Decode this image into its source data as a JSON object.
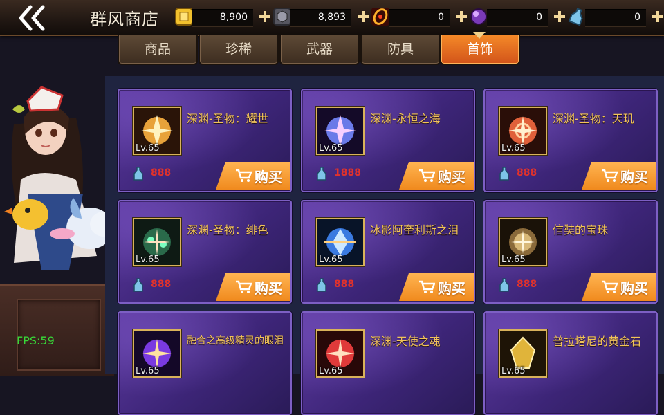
{
  "header": {
    "back_icon": "double-chevron-left-icon",
    "title": "群风商店",
    "currencies": [
      {
        "icon": "gold-coin-icon",
        "value": "8,900",
        "color": "#f2c12e"
      },
      {
        "icon": "silver-cube-icon",
        "value": "8,893",
        "color": "#a9a9b4"
      },
      {
        "icon": "fire-ring-icon",
        "value": "0",
        "color": "#e33c1f"
      },
      {
        "icon": "purple-orb-icon",
        "value": "0",
        "color": "#a05ad8"
      },
      {
        "icon": "blue-bottle-icon",
        "value": "0",
        "color": "#7ec4e8"
      }
    ],
    "plus_icon": "plus-icon"
  },
  "tabs": [
    {
      "label": "商品",
      "active": false
    },
    {
      "label": "珍稀",
      "active": false
    },
    {
      "label": "武器",
      "active": false
    },
    {
      "label": "防具",
      "active": false
    },
    {
      "label": "首饰",
      "active": true
    }
  ],
  "fps": "FPS:59",
  "items": [
    {
      "name": "深渊-圣物：耀世",
      "level": "Lv.65",
      "price": "888",
      "buy": "购买",
      "accent": "#e8a23a"
    },
    {
      "name": "深渊-永恒之海",
      "level": "Lv.65",
      "price": "1888",
      "buy": "购买",
      "accent": "#6a7ae8"
    },
    {
      "name": "深渊-圣物：天玑",
      "level": "Lv.65",
      "price": "888",
      "buy": "购买",
      "accent": "#e0603a"
    },
    {
      "name": "深渊-圣物：绯色",
      "level": "Lv.65",
      "price": "888",
      "buy": "购买",
      "accent": "#3ab07a"
    },
    {
      "name": "冰影阿奎利斯之泪",
      "level": "Lv.65",
      "price": "888",
      "buy": "购买",
      "accent": "#3a7ae0"
    },
    {
      "name": "信奘的宝珠",
      "level": "Lv.65",
      "price": "888",
      "buy": "购买",
      "accent": "#b0843a"
    },
    {
      "name": "融合之高级精灵的眼泪",
      "level": "Lv.65",
      "price": "",
      "buy": "",
      "accent": "#7a3ae0"
    },
    {
      "name": "深渊-天使之魂",
      "level": "Lv.65",
      "price": "",
      "buy": "",
      "accent": "#e03a3a"
    },
    {
      "name": "普拉塔尼的黄金石",
      "level": "Lv.65",
      "price": "",
      "buy": "",
      "accent": "#e0b43a"
    }
  ]
}
